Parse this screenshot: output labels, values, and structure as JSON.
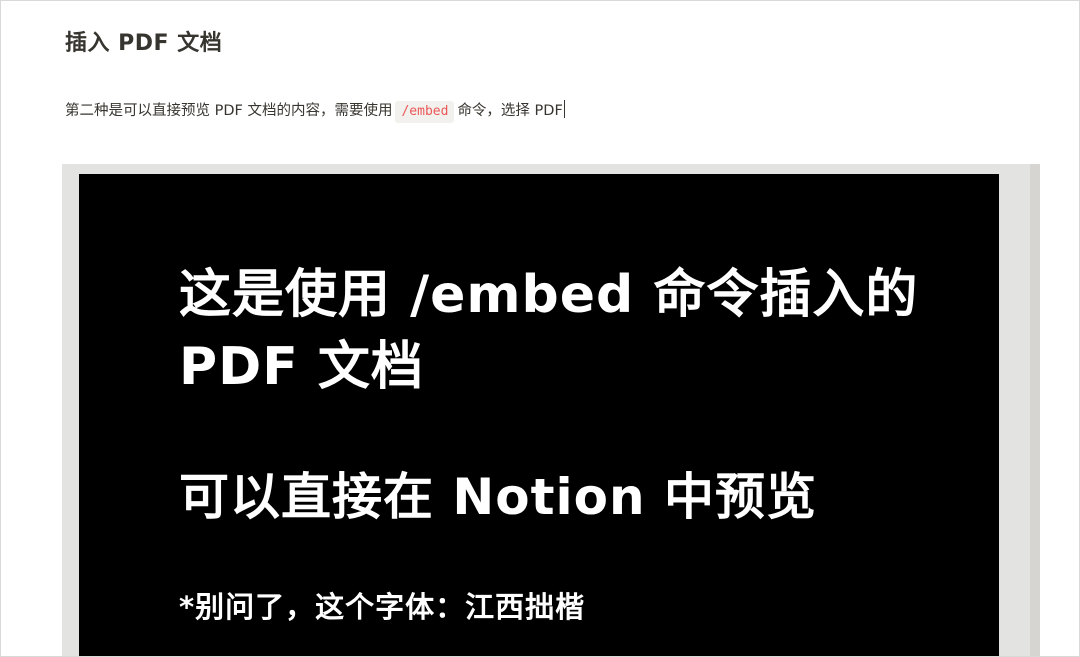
{
  "heading": "插入 PDF 文档",
  "paragraph": {
    "text_before": "第二种是可以直接预览 PDF 文档的内容，需要使用",
    "code": "/embed",
    "text_after": "命令，选择 PDF"
  },
  "pdf": {
    "line1": "这是使用 /embed 命令插入的",
    "line2": "PDF 文档",
    "line3": "可以直接在 Notion 中预览",
    "line4": "*别问了，这个字体：江西拙楷"
  },
  "colors": {
    "text": "#37352f",
    "code_text": "#eb5757",
    "code_bg": "#f2f1ee",
    "embed_bg": "#e3e3e1",
    "pdf_bg": "#000000"
  }
}
